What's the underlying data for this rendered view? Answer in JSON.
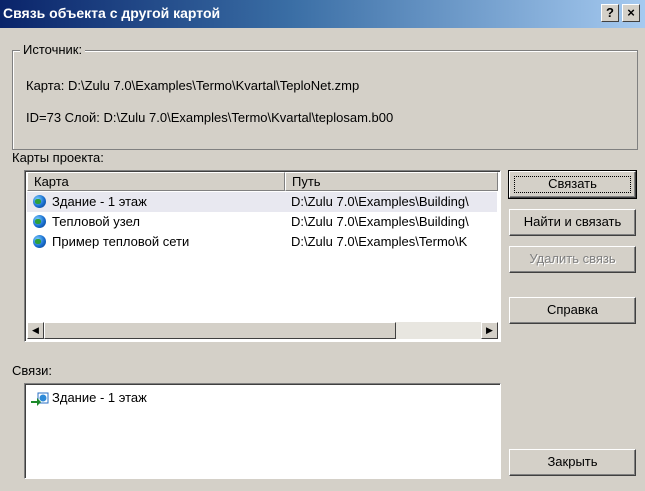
{
  "window": {
    "title": "Связь объекта с другой картой",
    "help_button": "?",
    "close_button": "×"
  },
  "source": {
    "legend": "Источник:",
    "map_line": "Карта: D:\\Zulu 7.0\\Examples\\Termo\\Kvartal\\TeploNet.zmp",
    "id_line": "ID=73  Слой: D:\\Zulu 7.0\\Examples\\Termo\\Kvartal\\teplosam.b00"
  },
  "project_maps": {
    "label": "Карты проекта:",
    "columns": [
      "Карта",
      "Путь"
    ],
    "rows": [
      {
        "map": "Здание - 1 этаж",
        "path": "D:\\Zulu 7.0\\Examples\\Building\\"
      },
      {
        "map": "Тепловой узел",
        "path": "D:\\Zulu 7.0\\Examples\\Building\\"
      },
      {
        "map": "Пример тепловой сети",
        "path": "D:\\Zulu 7.0\\Examples\\Termo\\K"
      }
    ]
  },
  "links": {
    "label": "Связи:",
    "items": [
      {
        "label": "Здание - 1 этаж",
        "icon": "link-icon"
      }
    ]
  },
  "buttons": {
    "link": "Связать",
    "find_and_link": "Найти и связать",
    "remove_link": "Удалить связь",
    "help": "Справка",
    "close": "Закрыть"
  },
  "colors": {
    "titlebar_start": "#0a246a",
    "titlebar_end": "#a6caf0",
    "dialog_bg": "#d4d0c8"
  }
}
